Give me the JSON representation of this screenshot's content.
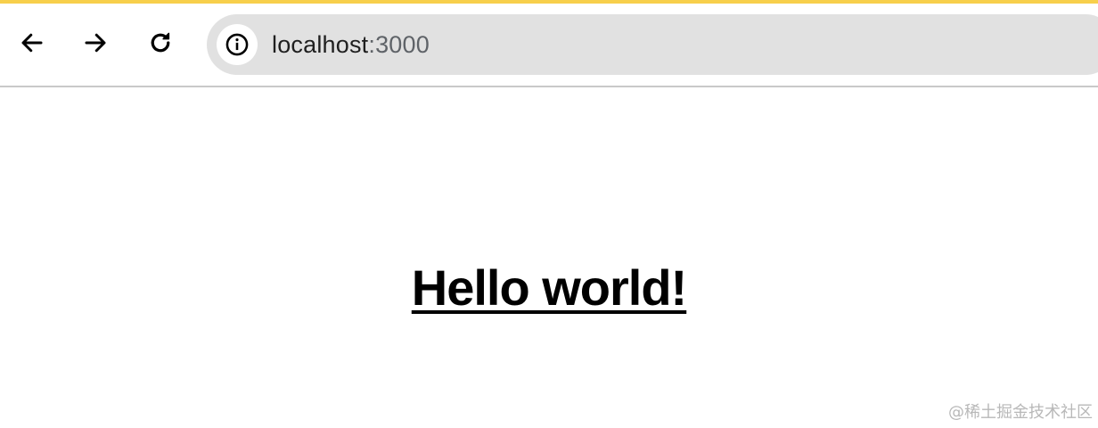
{
  "browser": {
    "accent_color": "#f7cf4b",
    "back_icon": "arrow-left-icon",
    "forward_icon": "arrow-right-icon",
    "reload_icon": "reload-icon",
    "site_info_icon": "info-icon",
    "url_host": "localhost",
    "url_port": ":3000"
  },
  "page": {
    "heading": "Hello world!"
  },
  "watermark": {
    "text": "@稀土掘金技术社区"
  }
}
